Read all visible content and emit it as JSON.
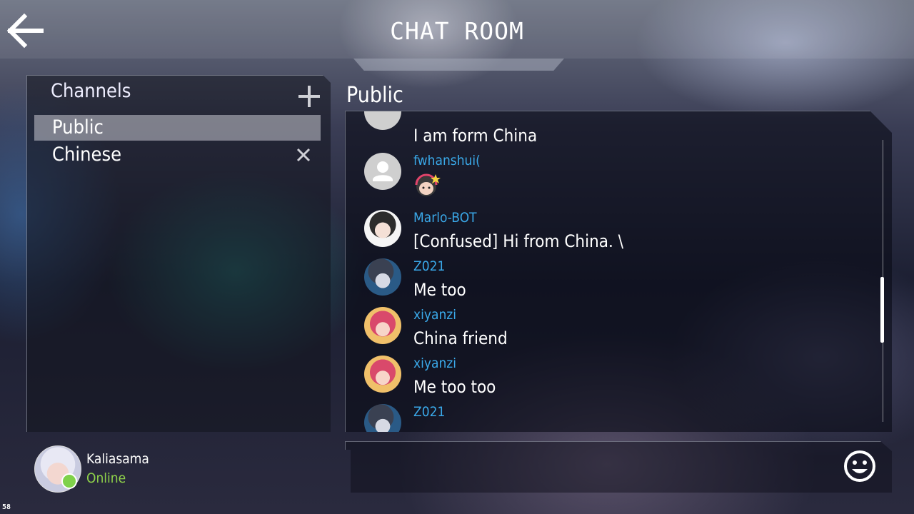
{
  "header": {
    "title": "CHAT ROOM"
  },
  "channels": {
    "header": "Channels",
    "items": [
      {
        "label": "Public",
        "selected": true
      },
      {
        "label": "Chinese",
        "selected": false
      }
    ]
  },
  "user": {
    "name": "Kaliasama",
    "status": "Online"
  },
  "chat": {
    "channel_title": "Public",
    "messages": [
      {
        "sender": "",
        "text": "I am form China"
      },
      {
        "sender": "fwhanshui(",
        "text": ""
      },
      {
        "sender": "Marlo-BOT",
        "text": "[Confused] Hi from China. \\"
      },
      {
        "sender": "Z021",
        "text": "Me too"
      },
      {
        "sender": "xiyanzi",
        "text": "China friend"
      },
      {
        "sender": "xiyanzi",
        "text": "Me too too"
      },
      {
        "sender": "Z021",
        "text": ""
      }
    ]
  },
  "fps": "58",
  "colors": {
    "sender": "#3aa8e8",
    "online": "#8ed14a"
  }
}
